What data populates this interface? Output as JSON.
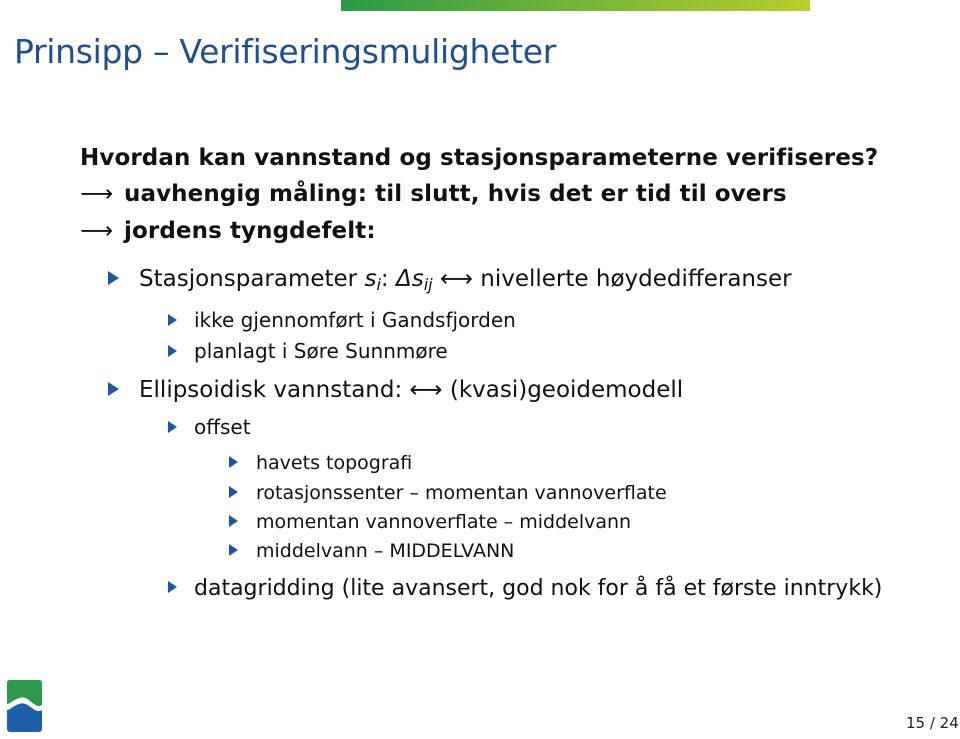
{
  "slide": {
    "title": "Prinsipp – Verifiseringsmuligheter",
    "question": "Hvordan kan vannstand og stasjonsparameterne verifiseres?",
    "arrow_lines": [
      {
        "arrow": "⟶",
        "text": "uavhengig måling: til slutt, hvis det er tid til overs"
      },
      {
        "arrow": "⟶",
        "text": "jordens tyngdefelt:"
      }
    ],
    "bullets": {
      "stasjon": {
        "label": "Stasjonsparameter",
        "var": "s",
        "var_sub": "i",
        "colon": ":",
        "delta": "Δs",
        "delta_sub": "ij",
        "arrow": "⟷",
        "rest": "nivellerte høydedifferanser",
        "sub_items": [
          "ikke gjennomført i Gandsfjorden",
          "planlagt i Søre Sunnmøre"
        ]
      },
      "ellipsoidisk": {
        "label": "Ellipsoidisk vannstand:",
        "arrow": "⟷",
        "rest": "(kvasi)geoidemodell",
        "offset_label": "offset",
        "offset_items": [
          "havets topografi",
          "rotasjonssenter – momentan vannoverflate",
          "momentan vannoverflate – middelvann",
          "middelvann – MIDDELVANN"
        ],
        "datagridding": "datagridding (lite avansert, god nok for å få et første inntrykk)"
      }
    },
    "page": {
      "current": "15",
      "total": "24",
      "label": "15 / 24"
    },
    "colors": {
      "title": "#1f4f8f",
      "bullet": "#1f57a3",
      "logo_green": "#2f9a4c",
      "logo_blue": "#1f5ea8",
      "bar_start": "#2a9a45",
      "bar_end": "#b9cd2a"
    }
  }
}
